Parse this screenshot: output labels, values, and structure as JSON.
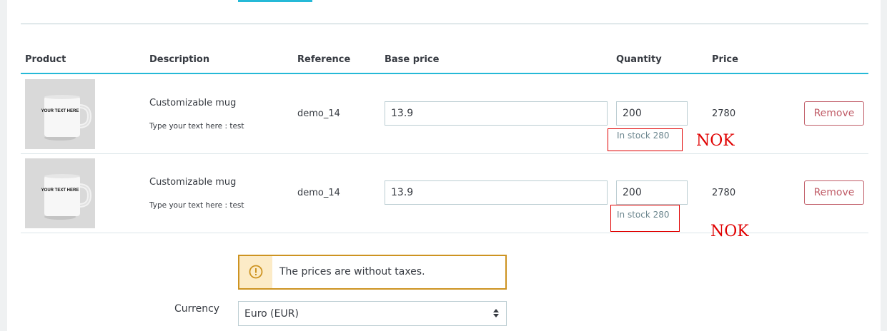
{
  "table": {
    "headers": {
      "product": "Product",
      "description": "Description",
      "reference": "Reference",
      "base_price": "Base price",
      "quantity": "Quantity",
      "price": "Price"
    },
    "rows": [
      {
        "thumb_text": "YOUR TEXT HERE",
        "name": "Customizable mug",
        "customization": "Type your text here : test",
        "reference": "demo_14",
        "base_price": "13.9",
        "quantity": "200",
        "stock": "In stock 280",
        "price": "2780",
        "remove_label": "Remove",
        "annotation": "NOK"
      },
      {
        "thumb_text": "YOUR TEXT HERE",
        "name": "Customizable mug",
        "customization": "Type your text here : test",
        "reference": "demo_14",
        "base_price": "13.9",
        "quantity": "200",
        "stock": "In stock 280",
        "price": "2780",
        "remove_label": "Remove",
        "annotation": "NOK"
      }
    ]
  },
  "alert": {
    "icon": "warning-icon",
    "text": "The prices are without taxes."
  },
  "currency": {
    "label": "Currency",
    "selected": "Euro (EUR)"
  },
  "colors": {
    "accent": "#25b9d7",
    "danger": "#c05c67",
    "warning_border": "#cd9321",
    "warning_bg": "#fcebc7",
    "annotation_red": "#e00000"
  }
}
